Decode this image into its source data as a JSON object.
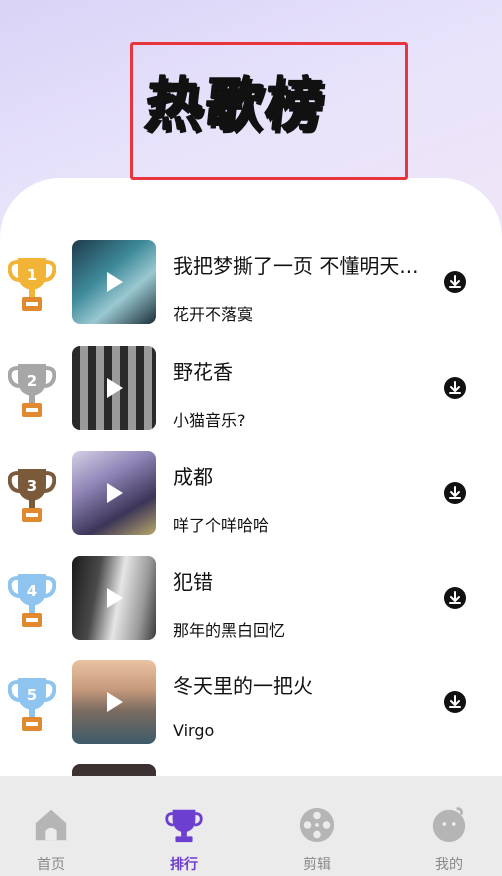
{
  "header": {
    "title": "热歌榜"
  },
  "songs": [
    {
      "rank": "1",
      "title": "我把梦撕了一页 不懂明天...",
      "artist": "花开不落寞",
      "trophy_color": "#f1b437"
    },
    {
      "rank": "2",
      "title": "野花香",
      "artist": "小猫音乐?",
      "trophy_color": "#a7a7a7"
    },
    {
      "rank": "3",
      "title": "成都",
      "artist": "咩了个咩哈哈",
      "trophy_color": "#7b5a3c"
    },
    {
      "rank": "4",
      "title": "犯错",
      "artist": "那年的黑白回忆",
      "trophy_color": "#8ec4ef"
    },
    {
      "rank": "5",
      "title": "冬天里的一把火",
      "artist": "Virgo",
      "trophy_color": "#8ec4ef"
    }
  ],
  "nav": {
    "items": [
      {
        "label": "首页",
        "icon": "home-icon"
      },
      {
        "label": "排行",
        "icon": "trophy-icon",
        "active": true
      },
      {
        "label": "剪辑",
        "icon": "film-reel-icon"
      },
      {
        "label": "我的",
        "icon": "profile-face-icon"
      }
    ],
    "active_color": "#6d3fd1",
    "inactive_color": "#b5b5b5"
  }
}
